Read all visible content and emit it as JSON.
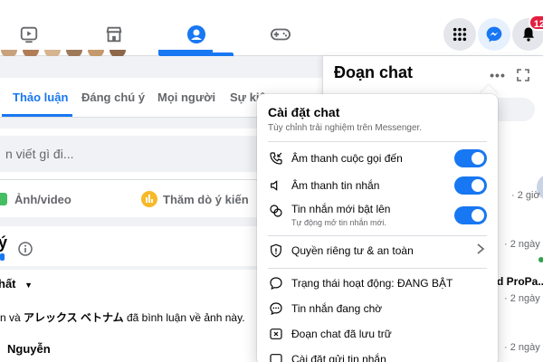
{
  "topnav": {
    "notifications_count": "12",
    "active_tab": "groups"
  },
  "tabs": [
    {
      "label": "Thảo luận"
    },
    {
      "label": "Đáng chú ý"
    },
    {
      "label": "Mọi người"
    },
    {
      "label": "Sự kiệ"
    }
  ],
  "composer": {
    "placeholder": "n viết gì đi...",
    "actions": [
      {
        "label": "Ảnh/video"
      },
      {
        "label": "Thăm dò ý kiến"
      }
    ]
  },
  "feed": {
    "heading_fragment": "ý",
    "sort_label": "hất",
    "activity_prefix": "n và ",
    "activity_name": "アレックス ベトナム",
    "activity_suffix": " đã bình luận về ảnh này.",
    "person_name": "Nguyễn"
  },
  "chat": {
    "title": "Đoạn chat",
    "items": [
      {
        "time": "· 2 giờ"
      },
      {
        "time": "· 2 ngày"
      },
      {
        "preview": "d ProPa...",
        "time": "· 2 ngày"
      },
      {
        "time": "· 2 ngày"
      }
    ]
  },
  "settings": {
    "title": "Cài đặt chat",
    "subtitle": "Tùy chỉnh trải nghiệm trên Messenger.",
    "toggles": [
      {
        "label": "Âm thanh cuộc gọi đến",
        "on": true
      },
      {
        "label": "Âm thanh tin nhắn",
        "on": true
      },
      {
        "label": "Tin nhắn mới bật lên",
        "sublabel": "Tự động mở tin nhắn mới.",
        "on": true
      }
    ],
    "privacy_label": "Quyền riêng tư & an toàn",
    "items": [
      {
        "label": "Trạng thái hoạt động: ĐANG BẬT"
      },
      {
        "label": "Tin nhắn đang chờ"
      },
      {
        "label": "Đoạn chat đã lưu trữ"
      },
      {
        "label": "Cài đặt gửi tin nhắn"
      }
    ]
  },
  "colors": {
    "brand": "#1877f2",
    "badge": "#e41e3f",
    "poll": "#f7b928",
    "photo": "#45bd62"
  }
}
